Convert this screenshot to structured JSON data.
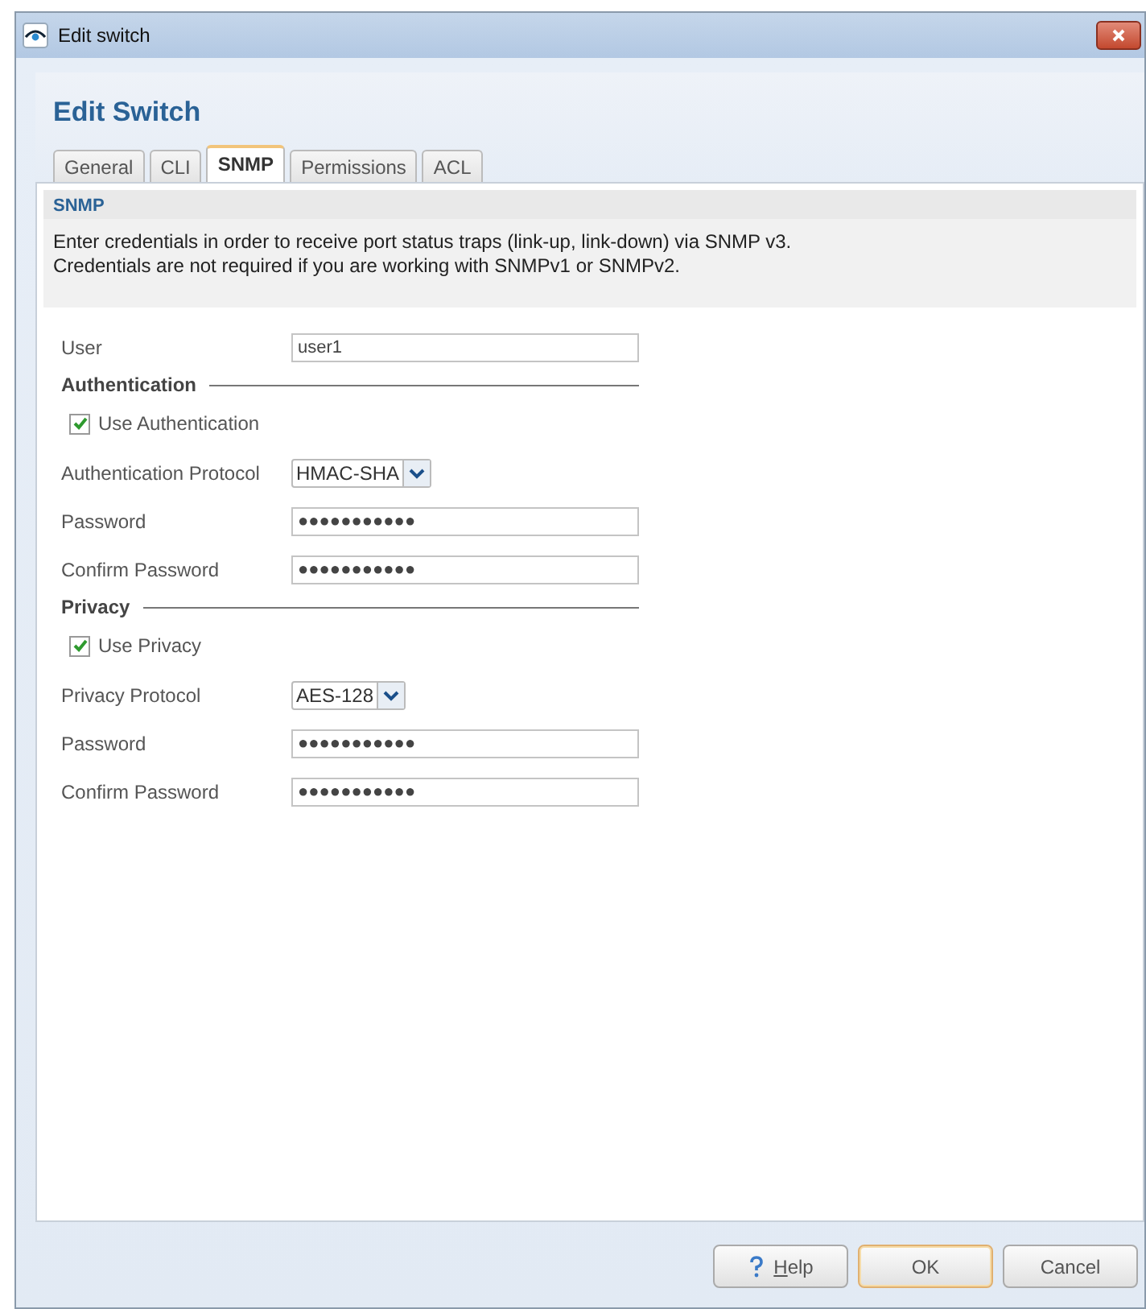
{
  "window": {
    "title": "Edit switch"
  },
  "heading": "Edit Switch",
  "tabs": [
    {
      "label": "General",
      "selected": false
    },
    {
      "label": "CLI",
      "selected": false
    },
    {
      "label": "SNMP",
      "selected": true
    },
    {
      "label": "Permissions",
      "selected": false
    },
    {
      "label": "ACL",
      "selected": false
    }
  ],
  "section": {
    "title": "SNMP",
    "description": [
      "Enter credentials in order to receive port status traps (link-up, link-down) via SNMP v3.",
      "Credentials are not required if you are working with SNMPv1 or SNMPv2."
    ]
  },
  "form": [
    {
      "kind": "text",
      "label": "User",
      "value": "user1"
    },
    {
      "kind": "group",
      "label": "Authentication"
    },
    {
      "kind": "checkbox",
      "label": "Use Authentication",
      "checked": true
    },
    {
      "kind": "select",
      "label": "Authentication Protocol",
      "value": "HMAC-SHA"
    },
    {
      "kind": "text",
      "label": "Password",
      "value": "●●●●●●●●●●●"
    },
    {
      "kind": "text",
      "label": "Confirm Password",
      "value": "●●●●●●●●●●●"
    },
    {
      "kind": "group",
      "label": "Privacy"
    },
    {
      "kind": "checkbox",
      "label": "Use Privacy",
      "checked": true
    },
    {
      "kind": "select",
      "label": "Privacy Protocol",
      "value": "AES-128"
    },
    {
      "kind": "text",
      "label": "Password",
      "value": "●●●●●●●●●●●"
    },
    {
      "kind": "text",
      "label": "Confirm Password",
      "value": "●●●●●●●●●●●"
    }
  ],
  "buttons": [
    {
      "label": "Help",
      "kind": "help",
      "mnemonic_underlined": true
    },
    {
      "label": "OK",
      "kind": "default",
      "mnemonic_underlined": false
    },
    {
      "label": "Cancel",
      "kind": "plain",
      "mnemonic_underlined": false
    }
  ]
}
